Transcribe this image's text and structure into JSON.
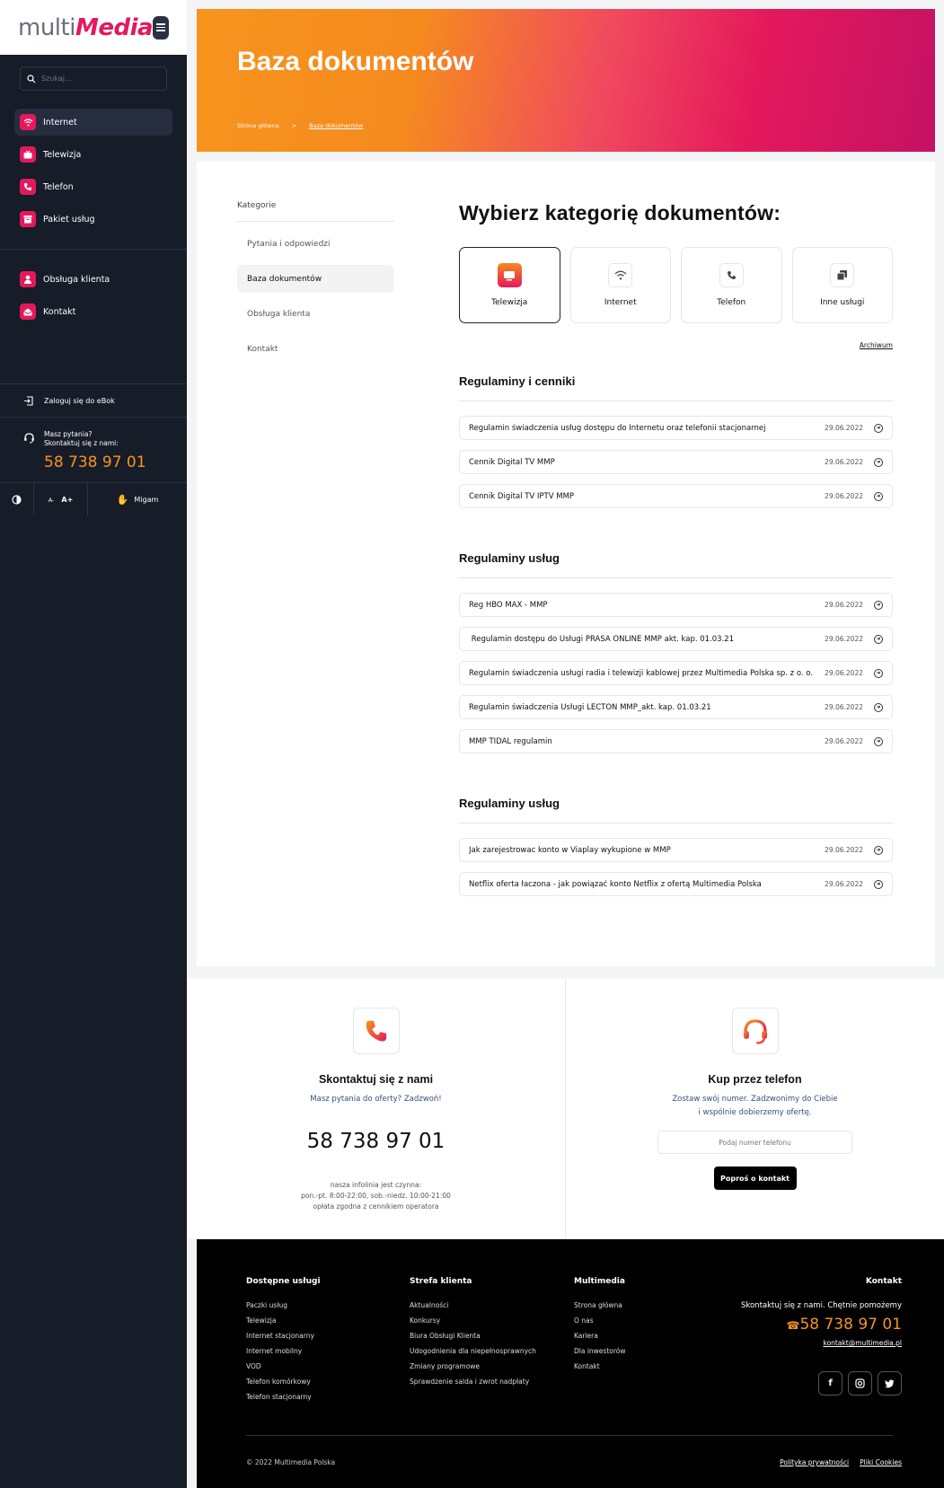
{
  "logo": {
    "part1": "multi",
    "part2": "Media"
  },
  "search": {
    "placeholder": "Szukaj..."
  },
  "nav": {
    "primary": [
      {
        "label": "Internet",
        "icon": "wifi-icon"
      },
      {
        "label": "Telewizja",
        "icon": "tv-icon"
      },
      {
        "label": "Telefon",
        "icon": "phone-icon"
      },
      {
        "label": "Pakiet usług",
        "icon": "package-icon"
      }
    ],
    "secondary": [
      {
        "label": "Obsługa klienta",
        "icon": "user-icon"
      },
      {
        "label": "Kontakt",
        "icon": "mail-icon"
      }
    ]
  },
  "sidebar_footer": {
    "ebok": "Zaloguj się do eBok",
    "help_q": "Masz pytania?",
    "help_c": "Skontaktuj się z nami:",
    "phone": "58 738 97 01",
    "font_small": "A-",
    "font_large": "A+",
    "migam": "Migam"
  },
  "hero": {
    "title": "Baza dokumentów",
    "crumb_home": "Strona główna",
    "crumb_sep": ">",
    "crumb_current": "Baza dokumentów"
  },
  "categories": {
    "title": "Kategorie",
    "items": [
      "Pytania i odpowiedzi",
      "Baza dokumentów",
      "Obsługa klienta",
      "Kontakt"
    ]
  },
  "content": {
    "heading": "Wybierz kategorię dokumentów:",
    "tiles": [
      {
        "label": "Telewizja",
        "icon": "tv-icon"
      },
      {
        "label": "Internet",
        "icon": "wifi-icon"
      },
      {
        "label": "Telefon",
        "icon": "phone-icon"
      },
      {
        "label": "Inne usługi",
        "icon": "stack-icon"
      }
    ],
    "archive": "Archiwum",
    "sections": [
      {
        "title": "Regulaminy i cenniki",
        "docs": [
          {
            "name": "Regulamin świadczenia usług dostępu do Internetu oraz telefonii stacjonarnej",
            "date": "29.06.2022"
          },
          {
            "name": "Cennik Digital TV MMP",
            "date": "29.06.2022"
          },
          {
            "name": "Cennik Digital TV IPTV MMP",
            "date": "29.06.2022"
          }
        ]
      },
      {
        "title": "Regulaminy usług",
        "docs": [
          {
            "name": "Reg HBO MAX - MMP",
            "date": "29.06.2022"
          },
          {
            "name": " Regulamin dostępu do Usługi PRASA ONLINE MMP akt. kap. 01.03.21",
            "date": "29.06.2022"
          },
          {
            "name": "Regulamin świadczenia usługi radia i telewizji kablowej przez Multimedia Polska sp. z o. o.",
            "date": "29.06.2022"
          },
          {
            "name": "Regulamin świadczenia Usługi LECTON MMP_akt. kap. 01.03.21",
            "date": "29.06.2022"
          },
          {
            "name": "MMP TIDAL regulamin",
            "date": "29.06.2022"
          }
        ]
      },
      {
        "title": "Regulaminy usług",
        "docs": [
          {
            "name": "Jak zarejestrowac konto w Viaplay wykupione w MMP",
            "date": "29.06.2022"
          },
          {
            "name": "Netflix oferta łaczona - jak powiązać konto Netflix z ofertą Multimedia Polska",
            "date": "29.06.2022"
          }
        ]
      }
    ]
  },
  "contact": {
    "left": {
      "title": "Skontaktuj się z nami",
      "sub": "Masz pytania do oferty? Zadzwoń!",
      "phone": "58 738 97 01",
      "note1": "nasza infolinia jest czynna:",
      "note2": "pon.-pt. 8:00-22:00, sob.-niedz. 10:00-21:00",
      "note3": "opłata zgodna z cennikiem operatora"
    },
    "right": {
      "title": "Kup przez telefon",
      "sub1": "Zostaw swój numer. Zadzwonimy do Ciebie",
      "sub2": "i wspólnie dobierzemy ofertę.",
      "input_placeholder": "Podaj numer telefonu",
      "button": "Poproś o kontakt"
    }
  },
  "footer": {
    "cols": [
      {
        "title": "Dostępne usługi",
        "links": [
          "Paczki usług",
          "Telewizja",
          "Internet stacjonarny",
          "Internet mobilny",
          "VOD",
          "Telefon komórkowy",
          "Telefon stacjonarny"
        ]
      },
      {
        "title": "Strefa klienta",
        "links": [
          "Aktualności",
          "Konkursy",
          "Biura Obsługi Klienta",
          "Udogodnienia dla niepełnosprawnych",
          "Zmiany programowe",
          "Sprawdzenie salda i zwrot nadpłaty"
        ]
      },
      {
        "title": "Multimedia",
        "links": [
          "Strona główna",
          "O nas",
          "Kariera",
          "Dla inwestorów",
          "Kontakt"
        ]
      }
    ],
    "contact_title": "Kontakt",
    "contact_lead": "Skontaktuj się z nami. Chętnie pomożemy",
    "phone": "58 738 97 01",
    "email": "kontakt@multimedia.pl",
    "copyright": "© 2022 Multimedia Polska",
    "privacy": "Polityka prywatności",
    "cookies": "Pliki Cookies"
  },
  "colors": {
    "accent": "#e4195c",
    "orange": "#f7941d",
    "sidebar": "#171c29"
  }
}
